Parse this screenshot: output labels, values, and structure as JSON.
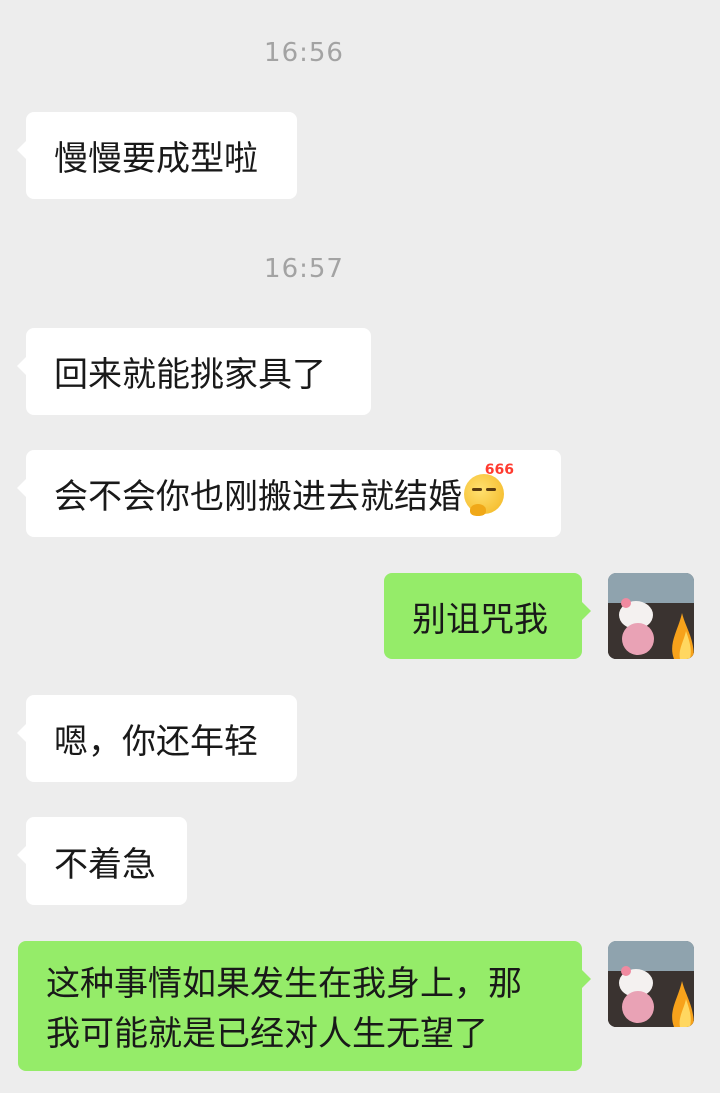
{
  "messages": {
    "ts1": "16:56",
    "m1": "慢慢要成型啦",
    "ts2": "16:57",
    "m2": "回来就能挑家具了",
    "m3": "会不会你也刚搬进去就结婚",
    "m3_emoji_badge": "666",
    "m3_emoji_icon": "smirk-666-emoji-icon",
    "m4": "别诅咒我",
    "m5": "嗯，你还年轻",
    "m6": "不着急",
    "m7": "这种事情如果发生在我身上，那我可能就是已经对人生无望了"
  },
  "colors": {
    "background": "#ededed",
    "incoming_bubble": "#ffffff",
    "outgoing_bubble": "#95ec69",
    "timestamp": "#a3a3a3"
  }
}
